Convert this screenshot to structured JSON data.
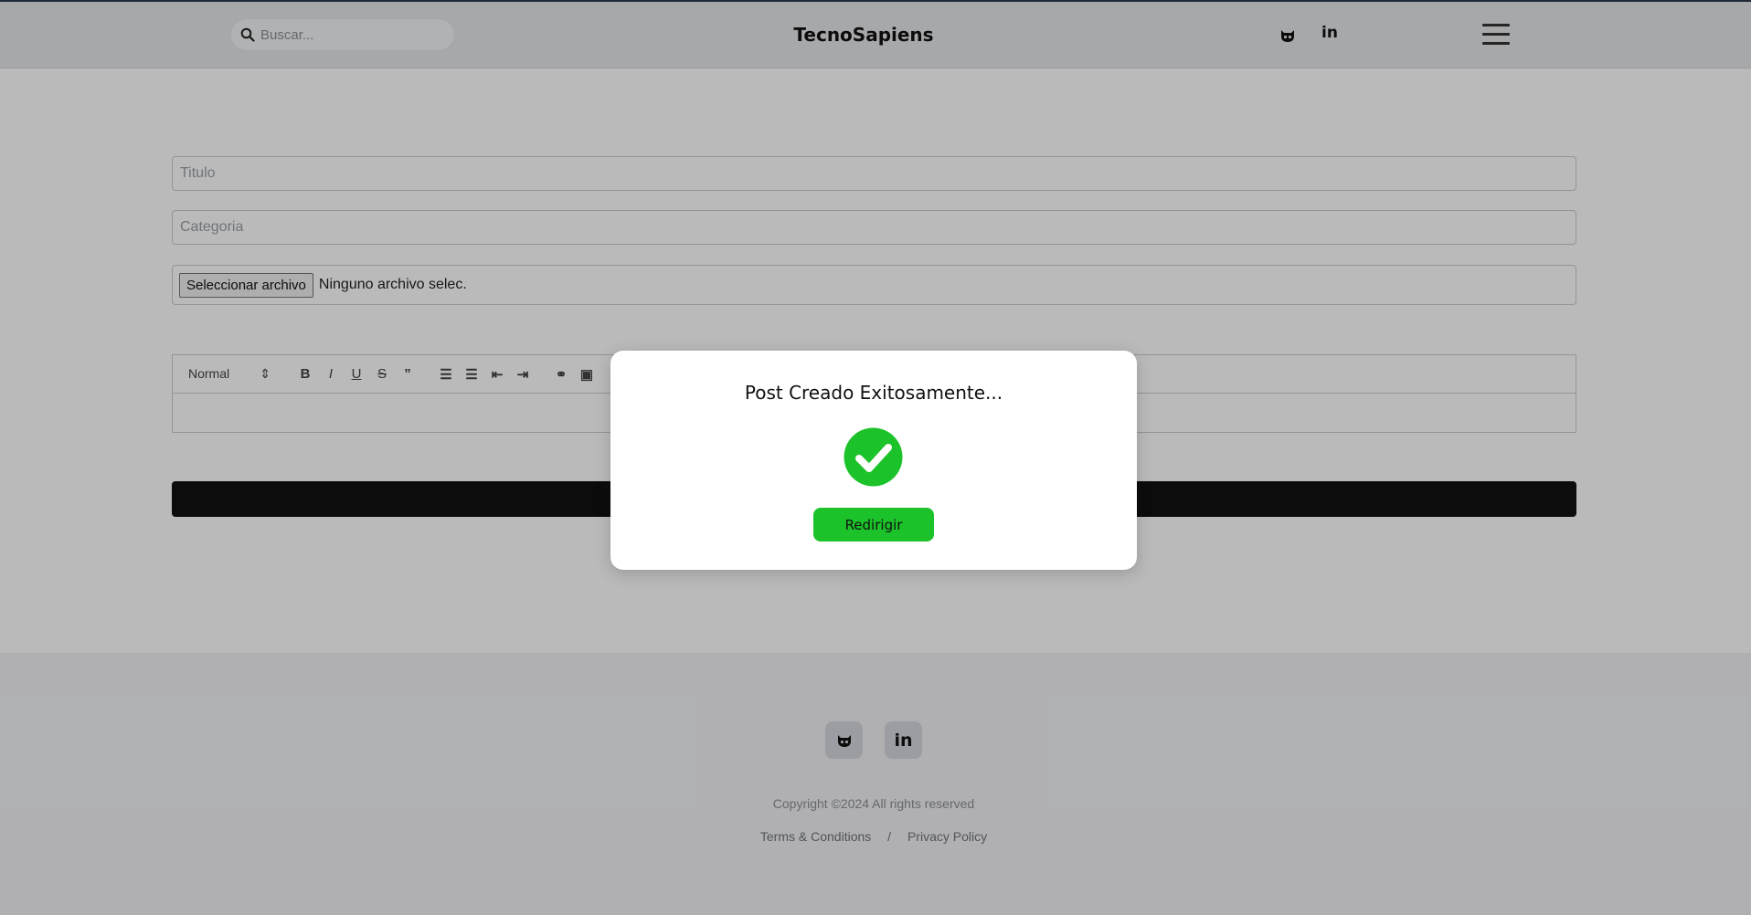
{
  "header": {
    "search_placeholder": "Buscar...",
    "brand": "TecnoSapiens",
    "linkedin_label": "in"
  },
  "form": {
    "title_placeholder": "Titulo",
    "category_placeholder": "Categoria",
    "file_button": "Seleccionar archivo",
    "file_status": "Ninguno archivo selec.",
    "toolbar_format": "Normal"
  },
  "modal": {
    "title": "Post Creado Exitosamente...",
    "button": "Redirigir",
    "accent": "#1cc22a"
  },
  "footer": {
    "linkedin_label": "in",
    "copyright": "Copyright ©2024 All rights reserved",
    "terms": "Terms & Conditions",
    "separator": "/",
    "privacy": "Privacy Policy"
  }
}
